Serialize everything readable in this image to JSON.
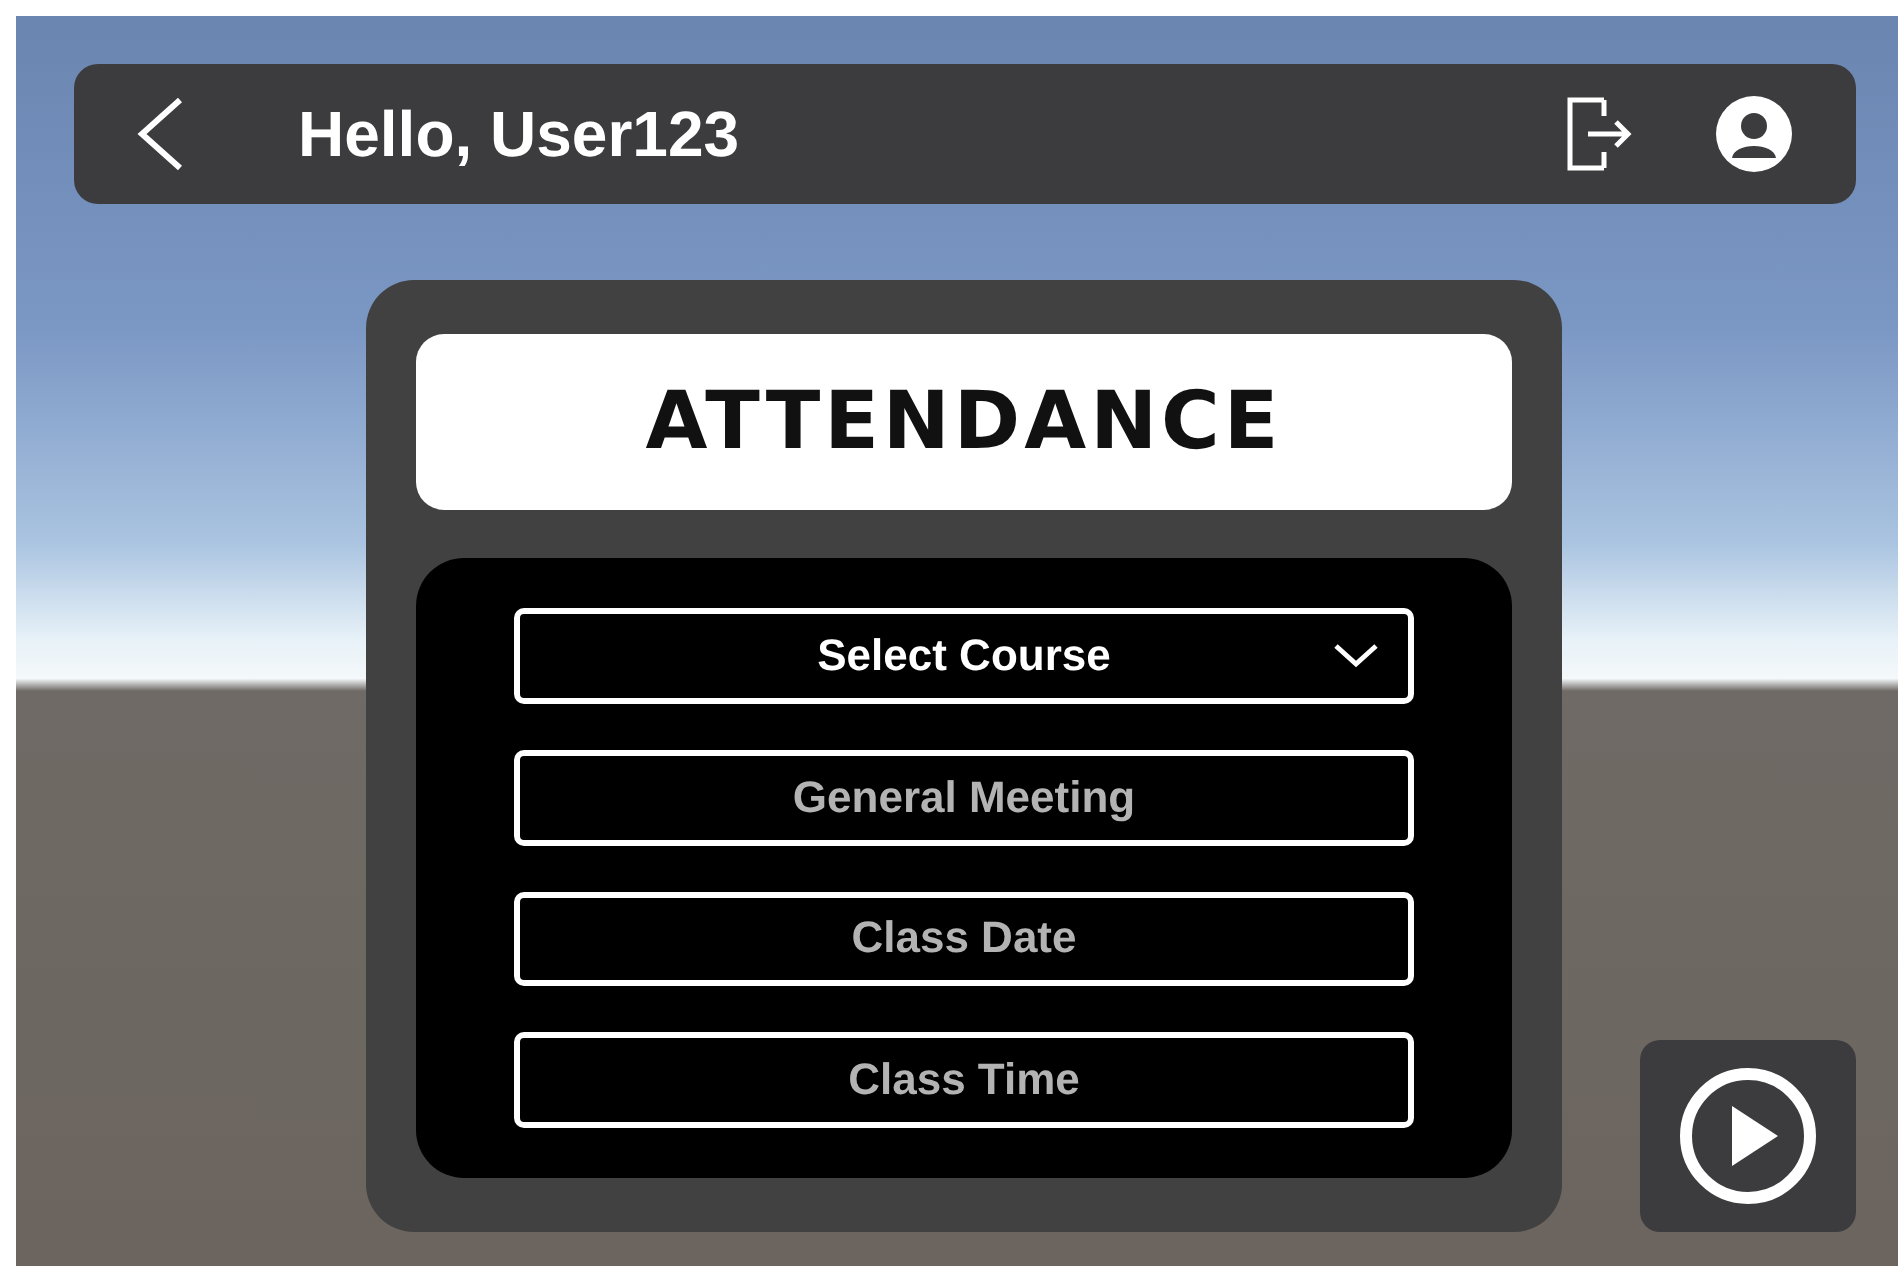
{
  "header": {
    "title": "Hello, User123"
  },
  "card": {
    "title": "ATTENDANCE",
    "fields": [
      {
        "kind": "dropdown",
        "value": "Select Course"
      },
      {
        "kind": "input",
        "placeholder": "General Meeting"
      },
      {
        "kind": "input",
        "placeholder": "Class Date"
      },
      {
        "kind": "input",
        "placeholder": "Class Time"
      }
    ]
  }
}
